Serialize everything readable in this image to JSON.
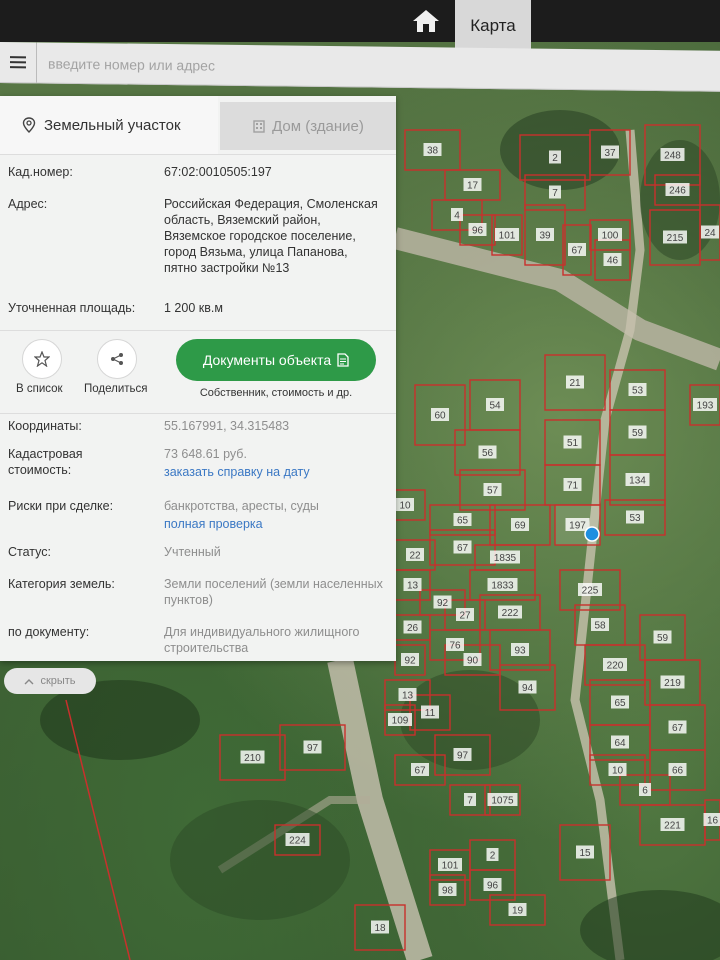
{
  "topbar": {
    "map_tab_label": "Карта"
  },
  "search": {
    "placeholder": "введите номер или адрес"
  },
  "panel": {
    "tab_active": "Земельный участок",
    "tab_inactive": "Дом (здание)",
    "fields": {
      "cadnum_label": "Кад.номер:",
      "cadnum_value": "67:02:0010505:197",
      "address_label": "Адрес:",
      "address_value": "Российская Федерация, Смоленская область, Вяземский район, Вяземское городское поселение, город Вязьма, улица Папанова, пятно застройки №13",
      "area_label": "Уточненная площадь:",
      "area_value": "1 200 кв.м"
    },
    "actions": {
      "to_list_label": "В список",
      "share_label": "Поделиться",
      "documents_button": "Документы объекта",
      "documents_sub": "Собственник, стоимость и др."
    },
    "details": {
      "coords_label": "Координаты:",
      "coords_value": "55.167991, 34.315483",
      "cost_label": "Кадастровая стоимость:",
      "cost_value": "73 648.61 руб.",
      "cost_link": "заказать справку на дату",
      "risks_label": "Риски при сделке:",
      "risks_value": "банкротства, аресты, суды",
      "risks_link": "полная проверка",
      "status_label": "Статус:",
      "status_value": "Учтенный",
      "category_label": "Категория земель:",
      "category_value": "Земли поселений (земли населенных пунктов)",
      "usage_label": "по документу:",
      "usage_value": "Для индивидуального жилищного строительства"
    }
  },
  "hide_button": "скрыть",
  "map": {
    "plot_numbers": [
      "38",
      "2",
      "37",
      "248",
      "17",
      "7",
      "246",
      "4",
      "96",
      "101",
      "39",
      "100",
      "67",
      "215",
      "24",
      "46",
      "21",
      "53",
      "193",
      "60",
      "54",
      "51",
      "59",
      "56",
      "71",
      "134",
      "57",
      "10",
      "65",
      "69",
      "197",
      "53",
      "22",
      "67",
      "1835",
      "13",
      "92",
      "1833",
      "225",
      "26",
      "27",
      "222",
      "76",
      "58",
      "59",
      "90",
      "92",
      "93",
      "220",
      "13",
      "94",
      "219",
      "109",
      "11",
      "65",
      "210",
      "97",
      "97",
      "64",
      "67",
      "10",
      "66",
      "67",
      "6",
      "7",
      "1075",
      "224",
      "221",
      "16",
      "101",
      "2",
      "15",
      "98",
      "96",
      "19",
      "18"
    ],
    "selected_plot": "197"
  },
  "colors": {
    "accent_green": "#2e9a48",
    "link_blue": "#3b78c4",
    "plot_border": "#c9302c",
    "marker": "#1e8fe0"
  }
}
